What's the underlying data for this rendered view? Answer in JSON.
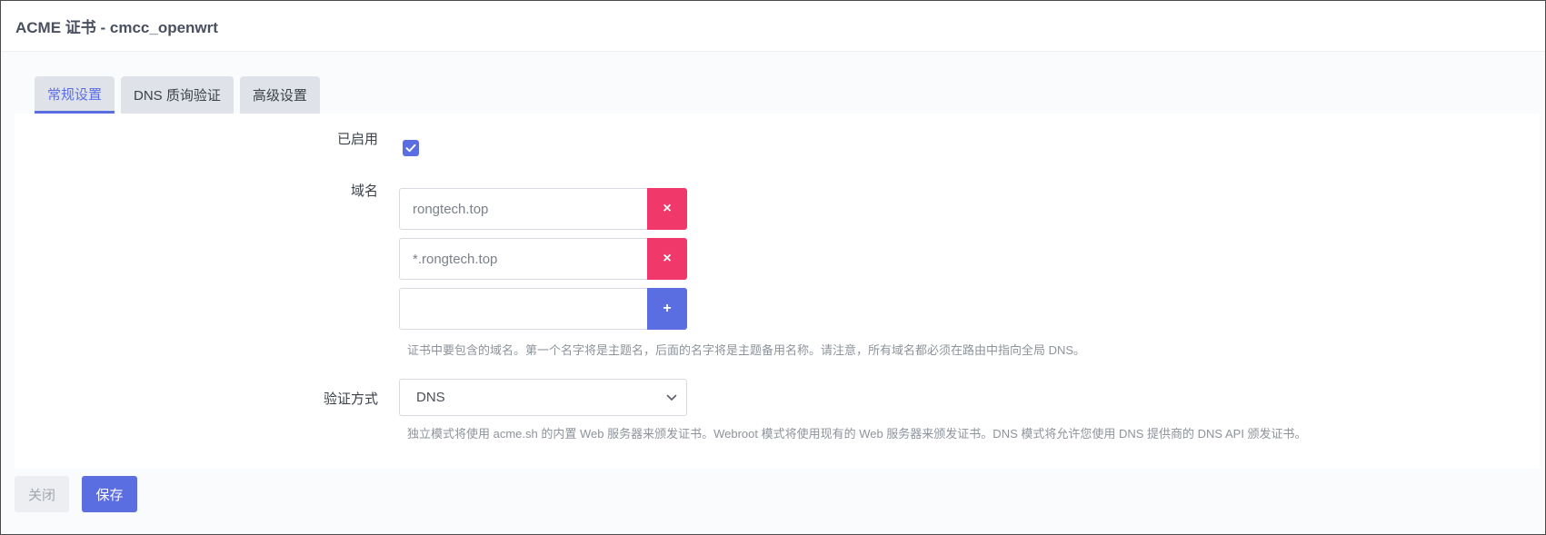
{
  "window": {
    "title": "ACME 证书 - cmcc_openwrt"
  },
  "tabs": [
    {
      "label": "常规设置",
      "active": true
    },
    {
      "label": "DNS 质询验证",
      "active": false
    },
    {
      "label": "高级设置",
      "active": false
    }
  ],
  "form": {
    "enabled": {
      "label": "已启用",
      "checked": true
    },
    "domains": {
      "label": "域名",
      "entries": [
        {
          "value": "rongtech.top",
          "button_icon": "close-icon"
        },
        {
          "value": "*.rongtech.top",
          "button_icon": "close-icon"
        },
        {
          "value": "",
          "button_icon": "plus-icon"
        }
      ],
      "remove_symbol": "×",
      "add_symbol": "+",
      "hint": "证书中要包含的域名。第一个名字将是主题名，后面的名字将是主题备用名称。请注意，所有域名都必须在路由中指向全局 DNS。"
    },
    "validation": {
      "label": "验证方式",
      "selected": "DNS",
      "hint": "独立模式将使用 acme.sh 的内置 Web 服务器来颁发证书。Webroot 模式将使用现有的 Web 服务器来颁发证书。DNS 模式将允许您使用 DNS 提供商的 DNS API 颁发证书。"
    }
  },
  "footer": {
    "close_label": "关闭",
    "save_label": "保存"
  },
  "colors": {
    "accent": "#5b6ee1",
    "danger": "#f0386a",
    "tab_bg": "#dfe3e9",
    "hint_text": "#8e939b"
  }
}
